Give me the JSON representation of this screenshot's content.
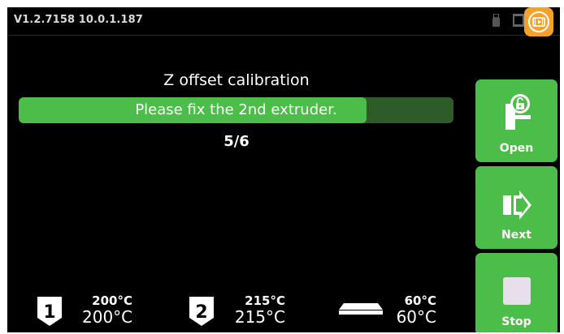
{
  "status_bar": {
    "version": "V1.2.7158  10.0.1.187"
  },
  "calibration": {
    "title": "Z offset calibration",
    "message": "Please fix the 2nd extruder.",
    "step": "5/6",
    "progress_fraction": 0.8
  },
  "side_buttons": {
    "open_label": "Open",
    "next_label": "Next",
    "stop_label": "Stop"
  },
  "temperatures": {
    "extruder1": {
      "number": "1",
      "target": "200°C",
      "current": "200°C"
    },
    "extruder2": {
      "number": "2",
      "target": "215°C",
      "current": "215°C"
    },
    "bed": {
      "target": "60°C",
      "current": "60°C"
    }
  },
  "colors": {
    "accent": "#4cbd49",
    "progress_track": "#2e5c28",
    "camera": "#f5a12a",
    "background": "#000000"
  },
  "icons": [
    "usb-icon",
    "sd-card-icon",
    "camera-icon",
    "door-unlock-icon",
    "next-arrow-icon",
    "stop-square-icon",
    "extruder-1-icon",
    "extruder-2-icon",
    "heated-bed-icon"
  ]
}
